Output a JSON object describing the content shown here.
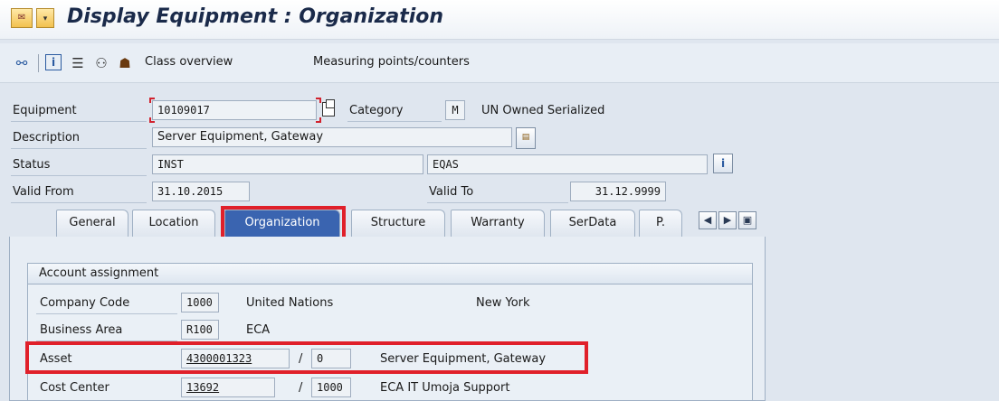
{
  "window": {
    "title": "Display Equipment : Organization"
  },
  "toolbar": {
    "buttons": [
      {
        "icon": "glasses-icon"
      },
      {
        "icon": "info-icon"
      },
      {
        "icon": "document-icon"
      },
      {
        "icon": "partners-icon"
      },
      {
        "icon": "hierarchy-icon"
      }
    ],
    "class_overview": "Class overview",
    "measuring_points": "Measuring points/counters"
  },
  "header": {
    "equipment_label": "Equipment",
    "equipment_value": "10109017",
    "category_label": "Category",
    "category_value": "M",
    "category_text": "UN Owned Serialized",
    "description_label": "Description",
    "description_value": "Server Equipment, Gateway",
    "status_label": "Status",
    "status_value": "INST",
    "status_user": "EQAS",
    "valid_from_label": "Valid From",
    "valid_from_value": "31.10.2015",
    "valid_to_label": "Valid To",
    "valid_to_value": "31.12.9999"
  },
  "tabs": [
    {
      "label": "General",
      "active": false
    },
    {
      "label": "Location",
      "active": false
    },
    {
      "label": "Organization",
      "active": true
    },
    {
      "label": "Structure",
      "active": false
    },
    {
      "label": "Warranty",
      "active": false
    },
    {
      "label": "SerData",
      "active": false
    },
    {
      "label": "P.",
      "active": false
    }
  ],
  "account_assignment": {
    "title": "Account assignment",
    "company_code_label": "Company Code",
    "company_code_value": "1000",
    "company_code_name": "United Nations",
    "company_code_city": "New York",
    "business_area_label": "Business Area",
    "business_area_value": "R100",
    "business_area_name": "ECA",
    "asset_label": "Asset",
    "asset_value": "4300001323",
    "asset_separator": "/",
    "asset_sub": "0",
    "asset_name": "Server Equipment, Gateway",
    "cost_center_label": "Cost Center",
    "cost_center_value": "13692",
    "cost_center_separator": "/",
    "cost_center_area": "1000",
    "cost_center_name": "ECA IT Umoja Support"
  },
  "colors": {
    "highlight": "#e0202a",
    "active_tab": "#3a64b0"
  }
}
